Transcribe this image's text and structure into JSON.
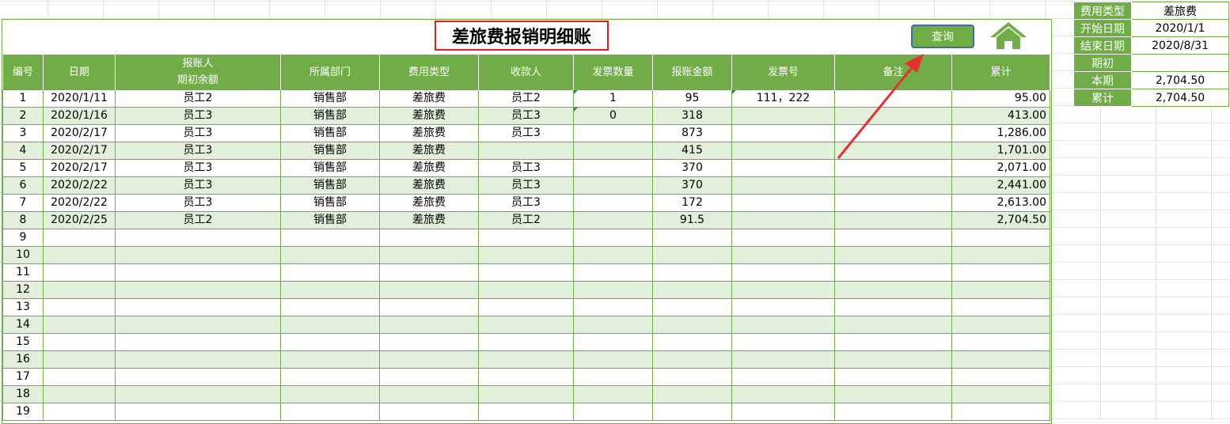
{
  "title": "差旅费报销明细账",
  "query_button": "查询",
  "icons": {
    "home": "home-icon",
    "arrow": "red-arrow-annotation"
  },
  "colors": {
    "header_green": "#70ad47",
    "alt_row": "#e2efda",
    "title_border": "#e02020",
    "arrow": "#e83030"
  },
  "headers": {
    "no": "编号",
    "date": "日期",
    "person_line1": "报账人",
    "person_line2": "期初余额",
    "dept": "所属部门",
    "type": "费用类型",
    "payee": "收款人",
    "invoice_count": "发票数量",
    "amount": "报账金额",
    "invoice_no": "发票号",
    "note": "备注",
    "cumulative": "累计"
  },
  "rows": [
    {
      "no": "1",
      "date": "2020/1/11",
      "person": "员工2",
      "dept": "销售部",
      "type": "差旅费",
      "payee": "员工2",
      "invoice_count": "1",
      "amount": "95",
      "invoice_no": "111，222",
      "note": "",
      "cumulative": "95.00"
    },
    {
      "no": "2",
      "date": "2020/1/16",
      "person": "员工3",
      "dept": "销售部",
      "type": "差旅费",
      "payee": "员工3",
      "invoice_count": "0",
      "amount": "318",
      "invoice_no": "",
      "note": "",
      "cumulative": "413.00"
    },
    {
      "no": "3",
      "date": "2020/2/17",
      "person": "员工3",
      "dept": "销售部",
      "type": "差旅费",
      "payee": "员工3",
      "invoice_count": "",
      "amount": "873",
      "invoice_no": "",
      "note": "",
      "cumulative": "1,286.00"
    },
    {
      "no": "4",
      "date": "2020/2/17",
      "person": "员工3",
      "dept": "销售部",
      "type": "差旅费",
      "payee": "",
      "invoice_count": "",
      "amount": "415",
      "invoice_no": "",
      "note": "",
      "cumulative": "1,701.00"
    },
    {
      "no": "5",
      "date": "2020/2/17",
      "person": "员工3",
      "dept": "销售部",
      "type": "差旅费",
      "payee": "员工3",
      "invoice_count": "",
      "amount": "370",
      "invoice_no": "",
      "note": "",
      "cumulative": "2,071.00"
    },
    {
      "no": "6",
      "date": "2020/2/22",
      "person": "员工3",
      "dept": "销售部",
      "type": "差旅费",
      "payee": "员工3",
      "invoice_count": "",
      "amount": "370",
      "invoice_no": "",
      "note": "",
      "cumulative": "2,441.00"
    },
    {
      "no": "7",
      "date": "2020/2/22",
      "person": "员工3",
      "dept": "销售部",
      "type": "差旅费",
      "payee": "员工3",
      "invoice_count": "",
      "amount": "172",
      "invoice_no": "",
      "note": "",
      "cumulative": "2,613.00"
    },
    {
      "no": "8",
      "date": "2020/2/25",
      "person": "员工2",
      "dept": "销售部",
      "type": "差旅费",
      "payee": "员工2",
      "invoice_count": "",
      "amount": "91.5",
      "invoice_no": "",
      "note": "",
      "cumulative": "2,704.50"
    },
    {
      "no": "9",
      "date": "",
      "person": "",
      "dept": "",
      "type": "",
      "payee": "",
      "invoice_count": "",
      "amount": "",
      "invoice_no": "",
      "note": "",
      "cumulative": ""
    },
    {
      "no": "10",
      "date": "",
      "person": "",
      "dept": "",
      "type": "",
      "payee": "",
      "invoice_count": "",
      "amount": "",
      "invoice_no": "",
      "note": "",
      "cumulative": ""
    },
    {
      "no": "11",
      "date": "",
      "person": "",
      "dept": "",
      "type": "",
      "payee": "",
      "invoice_count": "",
      "amount": "",
      "invoice_no": "",
      "note": "",
      "cumulative": ""
    },
    {
      "no": "12",
      "date": "",
      "person": "",
      "dept": "",
      "type": "",
      "payee": "",
      "invoice_count": "",
      "amount": "",
      "invoice_no": "",
      "note": "",
      "cumulative": ""
    },
    {
      "no": "13",
      "date": "",
      "person": "",
      "dept": "",
      "type": "",
      "payee": "",
      "invoice_count": "",
      "amount": "",
      "invoice_no": "",
      "note": "",
      "cumulative": ""
    },
    {
      "no": "14",
      "date": "",
      "person": "",
      "dept": "",
      "type": "",
      "payee": "",
      "invoice_count": "",
      "amount": "",
      "invoice_no": "",
      "note": "",
      "cumulative": ""
    },
    {
      "no": "15",
      "date": "",
      "person": "",
      "dept": "",
      "type": "",
      "payee": "",
      "invoice_count": "",
      "amount": "",
      "invoice_no": "",
      "note": "",
      "cumulative": ""
    },
    {
      "no": "16",
      "date": "",
      "person": "",
      "dept": "",
      "type": "",
      "payee": "",
      "invoice_count": "",
      "amount": "",
      "invoice_no": "",
      "note": "",
      "cumulative": ""
    },
    {
      "no": "17",
      "date": "",
      "person": "",
      "dept": "",
      "type": "",
      "payee": "",
      "invoice_count": "",
      "amount": "",
      "invoice_no": "",
      "note": "",
      "cumulative": ""
    },
    {
      "no": "18",
      "date": "",
      "person": "",
      "dept": "",
      "type": "",
      "payee": "",
      "invoice_count": "",
      "amount": "",
      "invoice_no": "",
      "note": "",
      "cumulative": ""
    },
    {
      "no": "19",
      "date": "",
      "person": "",
      "dept": "",
      "type": "",
      "payee": "",
      "invoice_count": "",
      "amount": "",
      "invoice_no": "",
      "note": "",
      "cumulative": ""
    }
  ],
  "summary": [
    {
      "label": "费用类型",
      "value": "差旅费"
    },
    {
      "label": "开始日期",
      "value": "2020/1/1"
    },
    {
      "label": "结束日期",
      "value": "2020/8/31"
    },
    {
      "label": "期初",
      "value": ""
    },
    {
      "label": "本期",
      "value": "2,704.50"
    },
    {
      "label": "累计",
      "value": "2,704.50"
    }
  ]
}
